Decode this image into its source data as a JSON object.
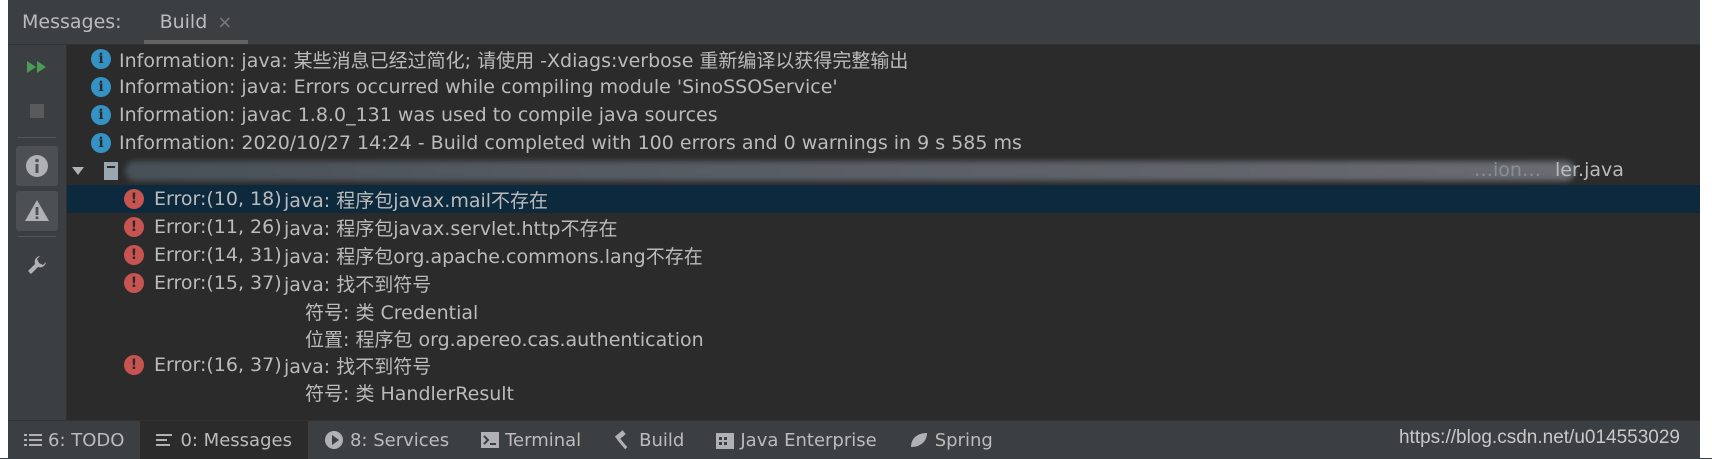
{
  "header": {
    "title": "Messages:",
    "tab_label": "Build",
    "tab_close": "×"
  },
  "colors": {
    "info": "#3592c4",
    "error": "#c75450",
    "selection": "#0d293e",
    "run": "#499c54"
  },
  "messages": [
    {
      "type": "info",
      "text": "Information: java: 某些消息已经过简化; 请使用 -Xdiags:verbose 重新编译以获得完整输出"
    },
    {
      "type": "info",
      "text": "Information: java: Errors occurred while compiling module 'SinoSSOService'"
    },
    {
      "type": "info",
      "text": "Information: javac 1.8.0_131 was used to compile java sources"
    },
    {
      "type": "info",
      "text": "Information: 2020/10/27 14:24 - Build completed with 100 errors and 0 warnings in 9 s 585 ms"
    }
  ],
  "file_node": {
    "name_suffix": "ler.java",
    "partial": "…ion…"
  },
  "errors": [
    {
      "pos": "Error:(10, 18)",
      "text": "java: 程序包javax.mail不存在"
    },
    {
      "pos": "Error:(11, 26)",
      "text": "java: 程序包javax.servlet.http不存在"
    },
    {
      "pos": "Error:(14, 31)",
      "text": "java: 程序包org.apache.commons.lang不存在"
    },
    {
      "pos": "Error:(15, 37)",
      "text": "java: 找不到符号"
    },
    {
      "pos": "Error:(16, 37)",
      "text": "java: 找不到符号"
    }
  ],
  "details": [
    {
      "text": "符号:   类 Credential"
    },
    {
      "text": "位置: 程序包 org.apereo.cas.authentication"
    },
    {
      "text": "符号:   类 HandlerResult"
    }
  ],
  "bottom_bar": {
    "items": [
      {
        "label": "6: TODO",
        "icon": "list-icon"
      },
      {
        "label": "0: Messages",
        "icon": "messages-icon"
      },
      {
        "label": "8: Services",
        "icon": "services-icon"
      },
      {
        "label": "Terminal",
        "icon": "terminal-icon"
      },
      {
        "label": "Build",
        "icon": "hammer-icon"
      },
      {
        "label": "Java Enterprise",
        "icon": "java-enterprise-icon"
      },
      {
        "label": "Spring",
        "icon": "spring-leaf-icon"
      }
    ],
    "watermark": "https://blog.csdn.net/u014553029"
  }
}
